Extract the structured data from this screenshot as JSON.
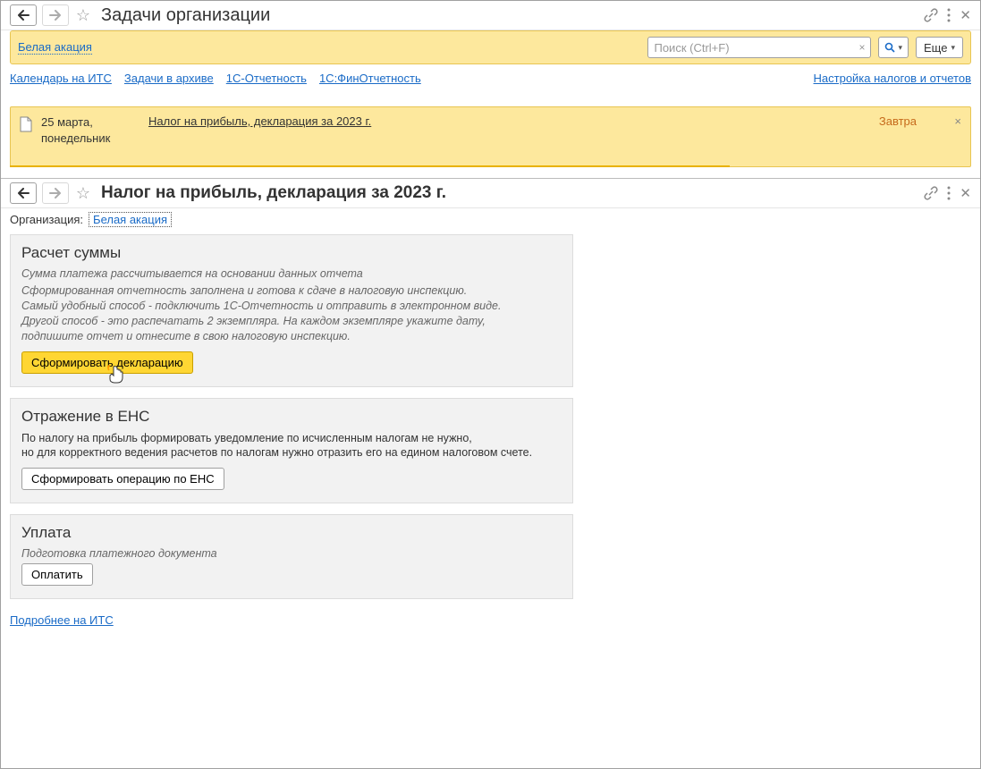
{
  "top": {
    "title": "Задачи организации",
    "search_placeholder": "Поиск (Ctrl+F)",
    "more_label": "Еще"
  },
  "org_banner": {
    "org_link": "Белая акация"
  },
  "links": {
    "l1": "Календарь на ИТС",
    "l2": "Задачи в архиве",
    "l3": "1С-Отчетность",
    "l4": "1С:ФинОтчетность",
    "right": "Настройка налогов и отчетов"
  },
  "task": {
    "date1": "25 марта,",
    "date2": "понедельник",
    "title": "Налог на прибыль, декларация за 2023 г.",
    "when": "Завтра"
  },
  "detail": {
    "title": "Налог на прибыль, декларация за 2023 г.",
    "org_label": "Организация:",
    "org_value": "Белая акация"
  },
  "sec1": {
    "h": "Расчет суммы",
    "note": "Сумма платежа рассчитывается на основании данных отчета",
    "p1": "Сформированная отчетность заполнена и готова к сдаче в налоговую инспекцию.",
    "p2": "Самый удобный способ - подключить 1С-Отчетность и отправить в электронном виде.",
    "p3": "Другой способ - это распечатать 2 экземпляра. На каждом экземпляре укажите дату,",
    "p4": "подпишите отчет и отнесите в свою налоговую инспекцию.",
    "btn": "Сформировать декларацию"
  },
  "sec2": {
    "h": "Отражение в ЕНС",
    "p1": "По налогу на прибыль формировать уведомление по исчисленным налогам не нужно,",
    "p2": "но для корректного ведения расчетов по налогам нужно отразить его на едином налоговом счете.",
    "btn": "Сформировать операцию по ЕНС"
  },
  "sec3": {
    "h": "Уплата",
    "note": "Подготовка платежного документа",
    "btn": "Оплатить"
  },
  "footer": {
    "link": "Подробнее на ИТС"
  }
}
